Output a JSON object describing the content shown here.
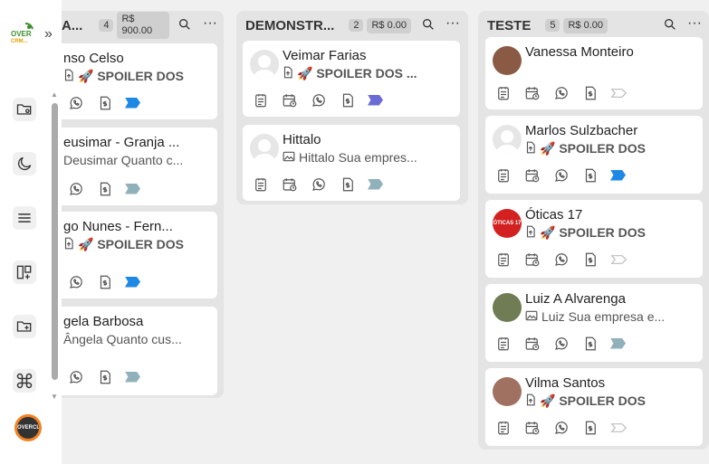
{
  "sidebar": {
    "logo_text": "OVER",
    "logo_sub": "CRM...",
    "expand_icon": "»",
    "icons": [
      "folder-settings-icon",
      "moon-icon",
      "menu-icon",
      "kanban-add-icon",
      "folder-add-icon",
      "command-icon"
    ],
    "avatar_text": "OVERCLOUD"
  },
  "columns": [
    {
      "title": "A...",
      "count": "4",
      "value": "R$ 900.00",
      "cards": [
        {
          "name": "nso Celso",
          "sub": "🚀 SPOILER DOS",
          "sub_bold": true,
          "tag_color": "#1e88e5"
        },
        {
          "name": "eusimar - Granja ...",
          "sub": "Deusimar Quanto c...",
          "sub_bold": false,
          "tag_color": "#90b0bc"
        },
        {
          "name": "go Nunes - Fern...",
          "sub": "🚀 SPOILER DOS",
          "sub_bold": true,
          "tag_color": "#1e88e5"
        },
        {
          "name": "gela Barbosa",
          "sub": "Ângela Quanto cus...",
          "sub_bold": false,
          "tag_color": "#90b0bc"
        }
      ]
    },
    {
      "title": "DEMONSTR...",
      "count": "2",
      "value": "R$ 0.00",
      "cards": [
        {
          "name": "Veimar Farias",
          "sub": "🚀 SPOILER DOS ...",
          "sub_bold": true,
          "tag_color": "#6b6bd6"
        },
        {
          "name": "Hittalo",
          "sub": "Hittalo Sua empres...",
          "sub_bold": false,
          "tag_color": "#90b0bc"
        }
      ]
    },
    {
      "title": "TESTE",
      "count": "5",
      "value": "R$ 0.00",
      "cards": [
        {
          "name": "Vanessa Monteiro",
          "sub": "",
          "sub_bold": false,
          "tag_color": "outline"
        },
        {
          "name": "Marlos Sulzbacher",
          "sub": "🚀 SPOILER DOS",
          "sub_bold": true,
          "tag_color": "#1e88e5"
        },
        {
          "name": "Óticas 17",
          "sub": "🚀 SPOILER DOS",
          "sub_bold": true,
          "tag_color": "outline",
          "avatar_text": "ÓTICAS 17"
        },
        {
          "name": "Luiz A Alvarenga",
          "sub": "Luiz Sua empresa e...",
          "sub_bold": false,
          "tag_color": "#90b0bc"
        },
        {
          "name": "Vilma Santos",
          "sub": "🚀 SPOILER DOS",
          "sub_bold": true,
          "tag_color": "outline"
        }
      ]
    }
  ],
  "icons": {
    "search": "search-icon",
    "more": "more-icon",
    "notes": "notes-icon",
    "calendar": "calendar-clock-icon",
    "whatsapp": "whatsapp-icon",
    "invoice": "invoice-icon",
    "tag": "tag-icon"
  }
}
